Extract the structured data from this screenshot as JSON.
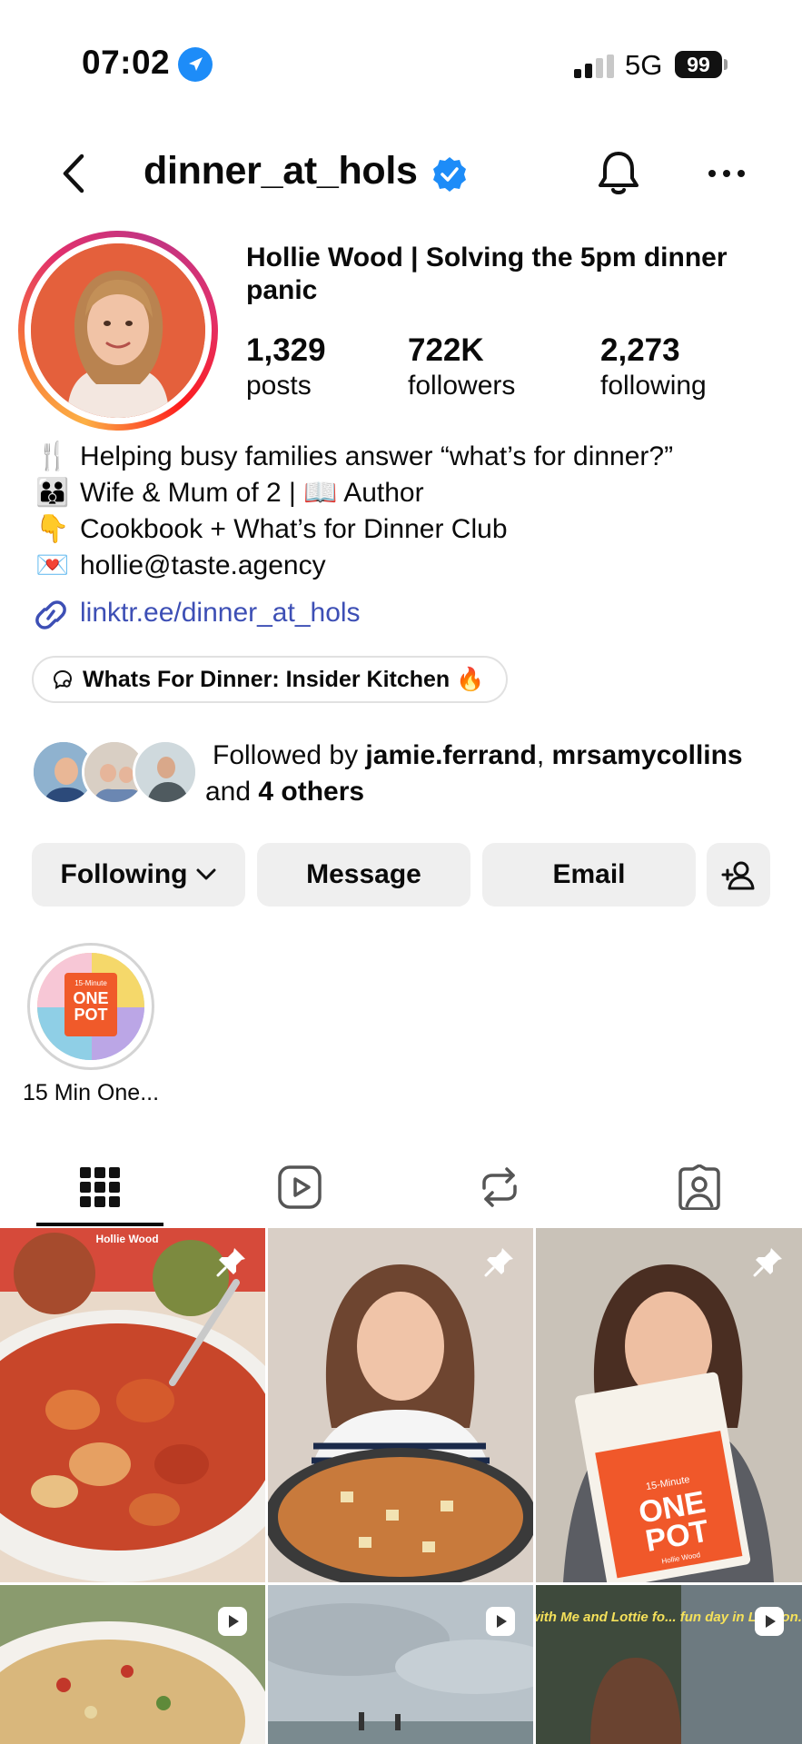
{
  "status_bar": {
    "time": "07:02",
    "network": "5G",
    "battery": "99",
    "icons": [
      "location-icon",
      "signal-icon"
    ]
  },
  "header": {
    "username": "dinner_at_hols",
    "icons": [
      "back-icon",
      "verified-icon",
      "bell-icon",
      "more-icon"
    ]
  },
  "profile": {
    "display_name": "Hollie Wood | Solving the 5pm dinner panic",
    "stats": [
      {
        "value": "1,329",
        "label": "posts"
      },
      {
        "value": "722K",
        "label": "followers"
      },
      {
        "value": "2,273",
        "label": "following"
      }
    ],
    "bio": [
      {
        "emoji": "🍴",
        "text": "Helping busy families answer “what’s for dinner?”"
      },
      {
        "emoji": "👪",
        "text": "Wife & Mum of 2 | 📖 Author"
      },
      {
        "emoji": "👇",
        "text": "Cookbook + What’s for Dinner Club"
      },
      {
        "emoji": "💌",
        "text": "hollie@taste.agency"
      }
    ],
    "link": "linktr.ee/dinner_at_hols",
    "channel": "Whats For Dinner: Insider Kitchen 🔥"
  },
  "followed_by": {
    "prefix": "Followed by ",
    "user1": "jamie.ferrand",
    "separator": ", ",
    "user2": "mrsamycollins",
    "and": " and ",
    "others": "4 others"
  },
  "actions": {
    "following": "Following",
    "message": "Message",
    "email": "Email"
  },
  "highlights": [
    {
      "label": "15 Min One...",
      "cover_line1": "15-Minute",
      "cover_line2": "ONE",
      "cover_line3": "POT"
    }
  ],
  "tabs": [
    "grid-icon",
    "reels-icon",
    "reposts-icon",
    "tagged-icon"
  ],
  "grid": {
    "post1_banner": "Hollie Wood",
    "post3_book": {
      "line1": "15-Minute",
      "line2": "ONE",
      "line3": "POT",
      "author": "Hollie Wood"
    },
    "post6_caption": "Come with Me and Lottie fo... fun day in London."
  },
  "colors": {
    "accent_link": "#3d4fb5",
    "verified": "#1d8cf8",
    "button_bg": "#efefef"
  }
}
